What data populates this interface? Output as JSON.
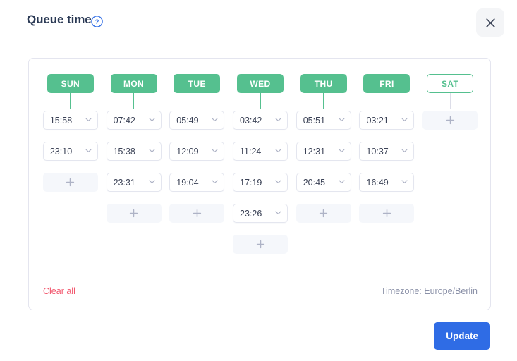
{
  "header": {
    "title": "Queue time",
    "help_icon": "question-circle-icon",
    "close_icon": "close-icon"
  },
  "schedule": {
    "columns": [
      {
        "day": "SUN",
        "selected": true,
        "slots": [
          {
            "type": "time",
            "value": "15:58"
          },
          {
            "type": "time",
            "value": "23:10"
          },
          {
            "type": "add"
          }
        ]
      },
      {
        "day": "MON",
        "selected": true,
        "slots": [
          {
            "type": "time",
            "value": "07:42"
          },
          {
            "type": "time",
            "value": "15:38"
          },
          {
            "type": "time",
            "value": "23:31"
          },
          {
            "type": "add"
          }
        ]
      },
      {
        "day": "TUE",
        "selected": true,
        "slots": [
          {
            "type": "time",
            "value": "05:49"
          },
          {
            "type": "time",
            "value": "12:09"
          },
          {
            "type": "time",
            "value": "19:04"
          },
          {
            "type": "add"
          }
        ]
      },
      {
        "day": "WED",
        "selected": true,
        "slots": [
          {
            "type": "time",
            "value": "03:42"
          },
          {
            "type": "time",
            "value": "11:24"
          },
          {
            "type": "time",
            "value": "17:19"
          },
          {
            "type": "time",
            "value": "23:26"
          },
          {
            "type": "add"
          }
        ]
      },
      {
        "day": "THU",
        "selected": true,
        "slots": [
          {
            "type": "time",
            "value": "05:51"
          },
          {
            "type": "time",
            "value": "12:31"
          },
          {
            "type": "time",
            "value": "20:45"
          },
          {
            "type": "add"
          }
        ]
      },
      {
        "day": "FRI",
        "selected": true,
        "slots": [
          {
            "type": "time",
            "value": "03:21"
          },
          {
            "type": "time",
            "value": "10:37"
          },
          {
            "type": "time",
            "value": "16:49"
          },
          {
            "type": "add"
          }
        ]
      },
      {
        "day": "SAT",
        "selected": false,
        "slots": [
          {
            "type": "add"
          }
        ]
      }
    ]
  },
  "card_footer": {
    "clear_all_label": "Clear all",
    "timezone_label": "Timezone: Europe/Berlin"
  },
  "modal_footer": {
    "update_label": "Update"
  },
  "colors": {
    "green": "#55c08f",
    "blue": "#2f6ce5",
    "red": "#f2566d",
    "title": "#2b3a55",
    "muted": "#8b91a8"
  }
}
